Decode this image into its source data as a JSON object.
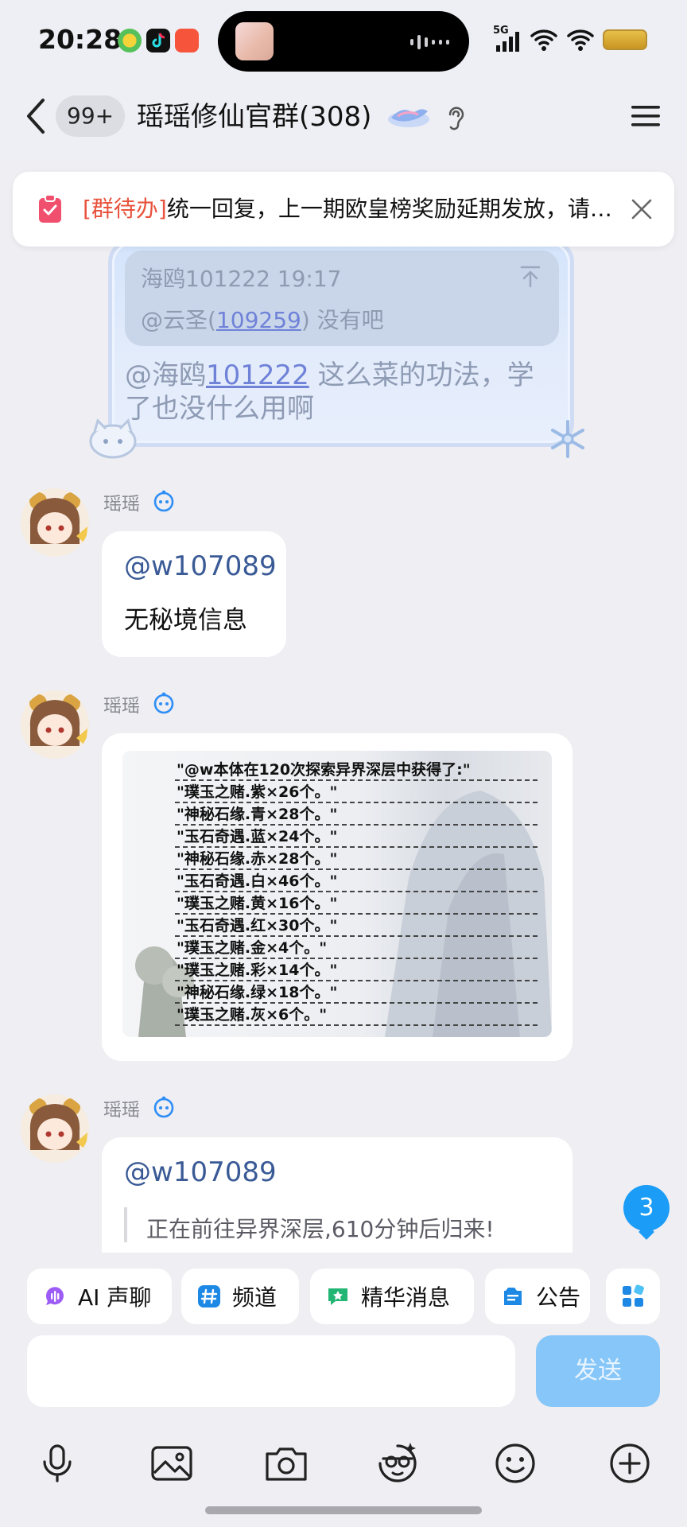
{
  "status_bar": {
    "time": "20:28",
    "network": "5G"
  },
  "header": {
    "unread_count": "99+",
    "title": "瑶瑶修仙官群(308)"
  },
  "todo": {
    "tag": "[群待办]",
    "text": "统一回复，上一期欧皇榜奖励延期发放，请耐心等待"
  },
  "fancy_message": {
    "quote_sender": "海鸥101222 19:17",
    "quote_prefix": "@云圣(",
    "quote_link": "109259",
    "quote_suffix": ") 没有吧",
    "text_prefix": "@海鸥",
    "text_link": "101222",
    "text_rest": " 这么菜的功法，学了也没什么用啊"
  },
  "messages": [
    {
      "sender": "瑶瑶",
      "mention": "@w107089",
      "text": "无秘境信息"
    },
    {
      "sender": "瑶瑶",
      "image_lines": [
        "\"@w本体在120次探索异界深层中获得了:\"",
        "\"璞玉之赌.紫×26个。\"",
        "\"神秘石缘.青×28个。\"",
        "\"玉石奇遇.蓝×24个。\"",
        "\"神秘石缘.赤×28个。\"",
        "\"玉石奇遇.白×46个。\"",
        "\"璞玉之赌.黄×16个。\"",
        "\"玉石奇遇.红×30个。\"",
        "\"璞玉之赌.金×4个。\"",
        "\"璞玉之赌.彩×14个。\"",
        "\"神秘石缘.绿×18个。\"",
        "\"璞玉之赌.灰×6个。\""
      ]
    },
    {
      "sender": "瑶瑶",
      "mention": "@w107089",
      "quote": "正在前往异界深层,610分钟后归来!"
    }
  ],
  "new_message_count": "3",
  "quick_actions": [
    {
      "label": "AI 声聊",
      "icon": "ai-voice-icon",
      "color": "#8b5cf6"
    },
    {
      "label": "频道",
      "icon": "channel-hash-icon",
      "color": "#1e88e5"
    },
    {
      "label": "精华消息",
      "icon": "essence-icon",
      "color": "#22b573"
    },
    {
      "label": "公告",
      "icon": "announcement-icon",
      "color": "#1e88e5"
    }
  ],
  "input": {
    "placeholder": "",
    "send_label": "发送"
  },
  "colors": {
    "accent": "#1a9cf7",
    "send_disabled": "#86c6f8",
    "todo_tag": "#e8533d",
    "mention": "#3a5a96"
  }
}
